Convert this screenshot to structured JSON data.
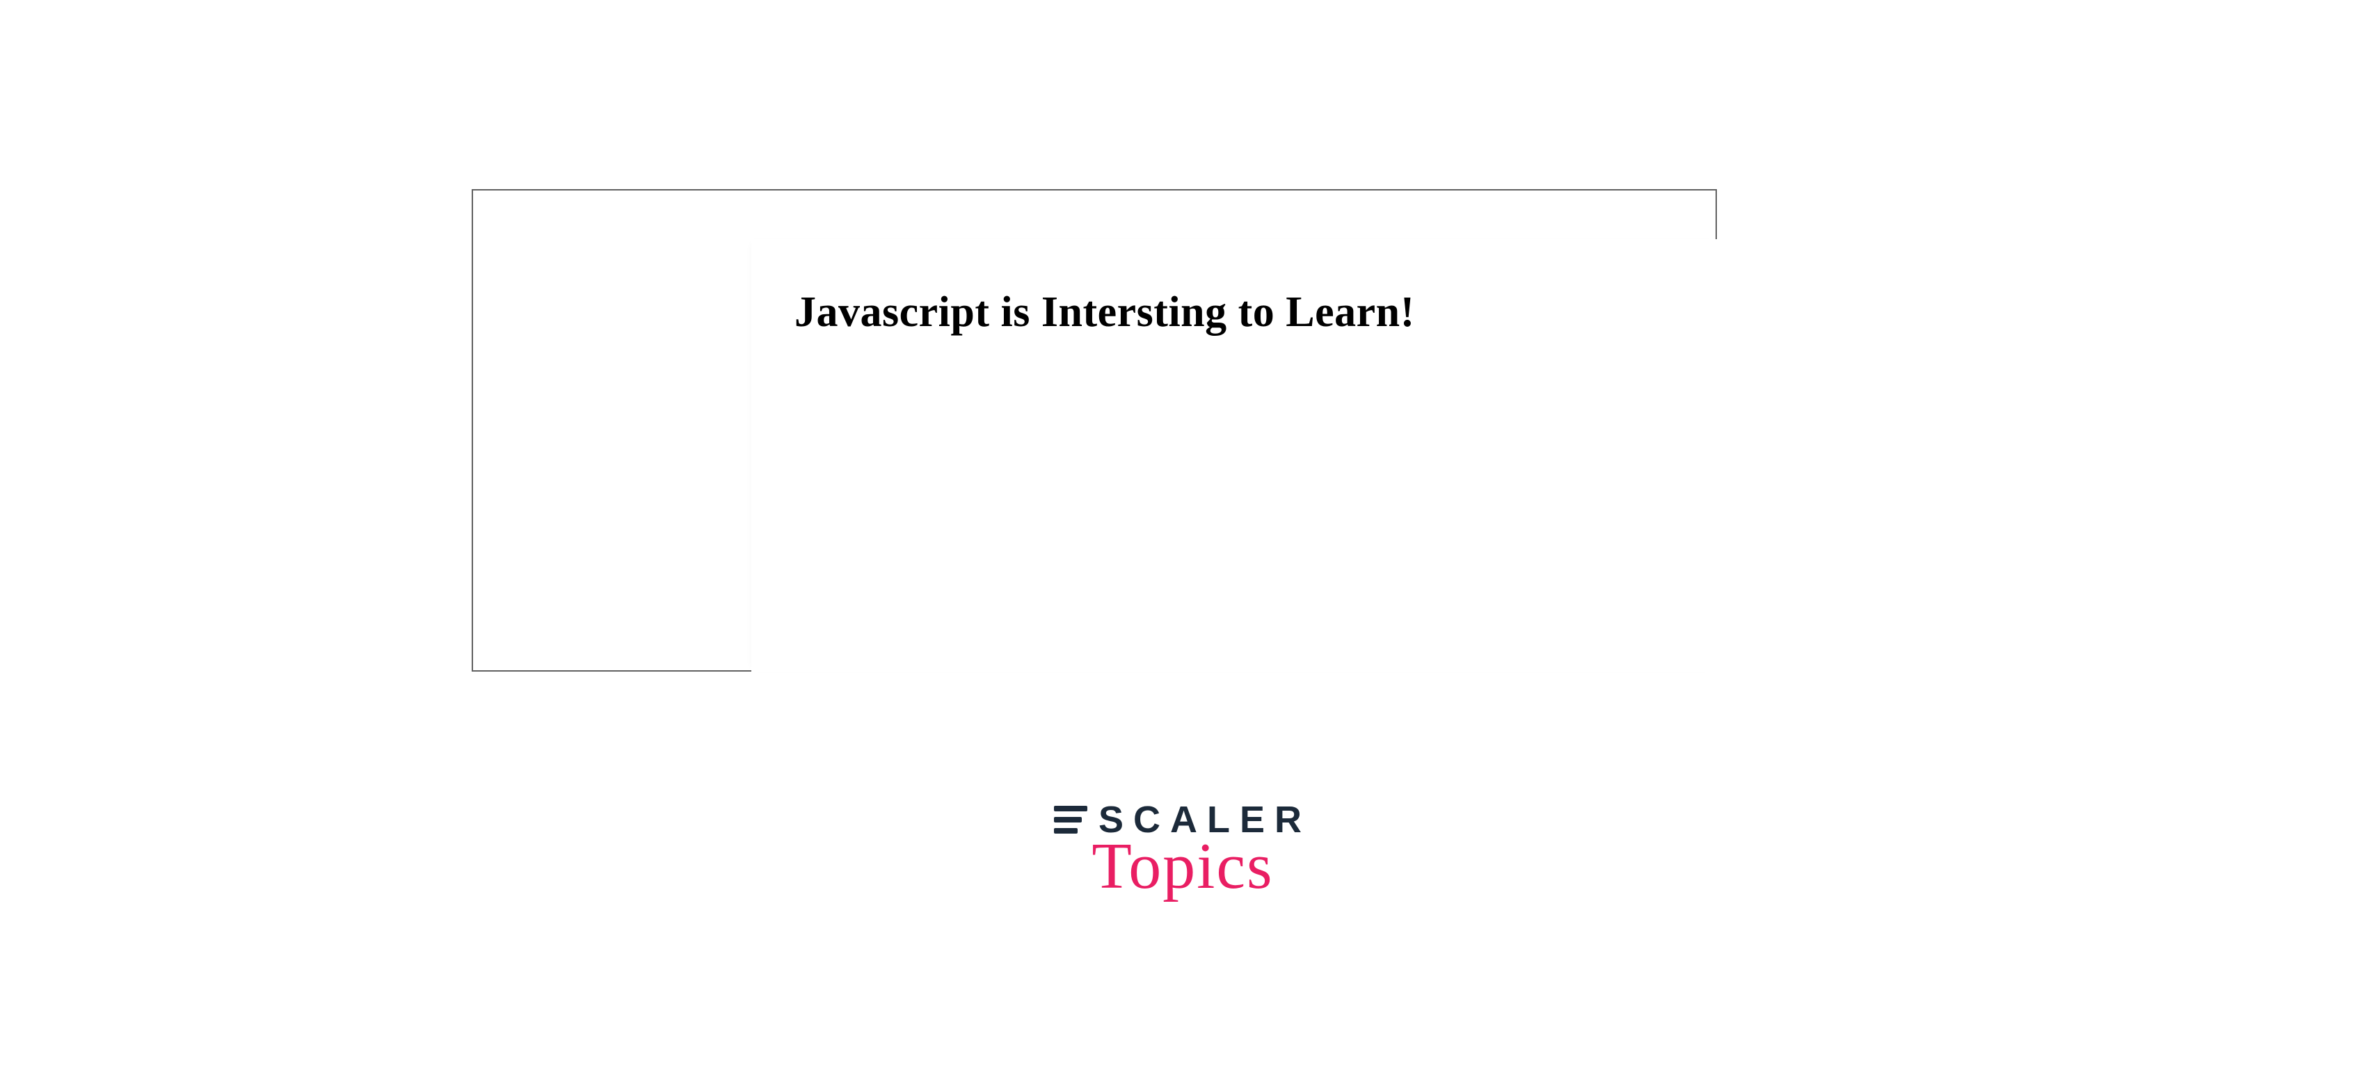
{
  "content": {
    "heading": "Javascript is Intersting to Learn!"
  },
  "logo": {
    "word": "SCALER",
    "subword": "Topics"
  },
  "colors": {
    "logo_navy": "#1c2a3a",
    "logo_pink": "#e91e63",
    "border_gray": "#606060"
  }
}
